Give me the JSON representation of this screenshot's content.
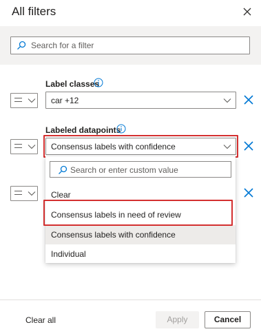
{
  "panel": {
    "title": "All filters",
    "close_icon": "close-icon"
  },
  "search": {
    "placeholder": "Search for a filter",
    "icon": "search-icon"
  },
  "filters": [
    {
      "label": "Label classes",
      "operator_icon": "equals-icon",
      "value": "car +12",
      "remove_icon": "close-icon"
    },
    {
      "label": "Labeled datapoints",
      "operator_icon": "equals-icon",
      "value": "Consensus labels with confidence",
      "remove_icon": "close-icon"
    },
    {
      "label": "",
      "operator_icon": "equals-icon",
      "value": "",
      "remove_icon": "close-icon"
    }
  ],
  "dropdown_menu": {
    "search_placeholder": "Search or enter custom value",
    "items": [
      {
        "label": "Clear",
        "selected": false
      },
      {
        "label": "Consensus labels in need of review",
        "selected": false
      },
      {
        "label": "Consensus labels with confidence",
        "selected": true
      },
      {
        "label": "Individual",
        "selected": false
      }
    ]
  },
  "footer": {
    "clear_all_label": "Clear all",
    "apply_label": "Apply",
    "cancel_label": "Cancel"
  },
  "colors": {
    "accent": "#0078d4",
    "highlight": "#d32f2f",
    "disabled_bg": "#f3f2f1",
    "band_bg": "#f3f2f1",
    "selected_bg": "#edebe9"
  }
}
